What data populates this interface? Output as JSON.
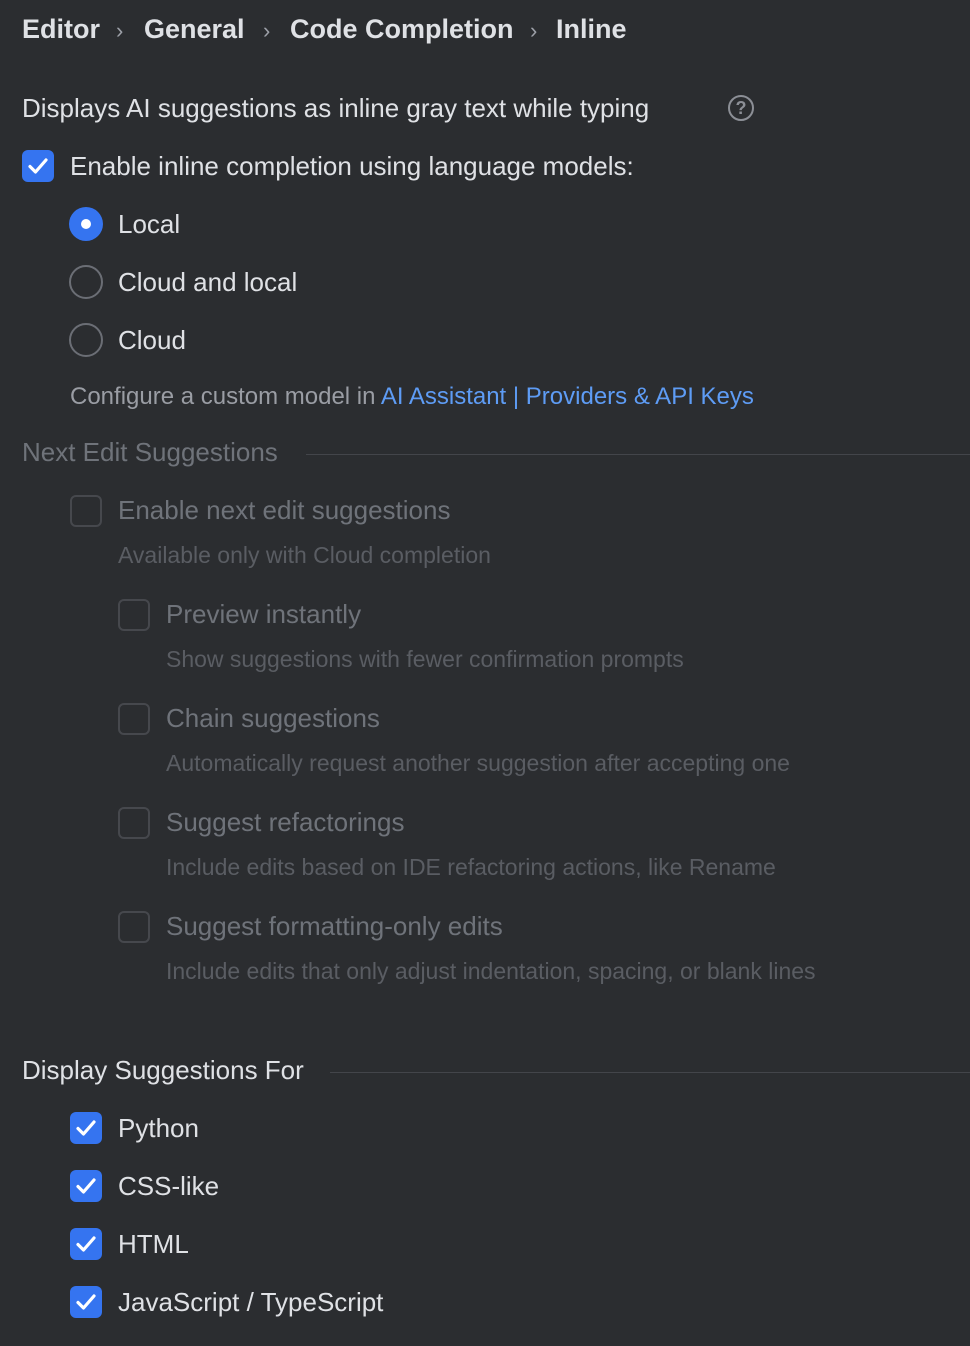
{
  "breadcrumb": {
    "items": [
      "Editor",
      "General",
      "Code Completion",
      "Inline"
    ],
    "separator": "›"
  },
  "description": "Displays AI suggestions as inline gray text while typing",
  "help_icon_glyph": "?",
  "enable_inline": {
    "label": "Enable inline completion using language models:",
    "checked": true
  },
  "model_options": [
    {
      "label": "Local",
      "selected": true
    },
    {
      "label": "Cloud and local",
      "selected": false
    },
    {
      "label": "Cloud",
      "selected": false
    }
  ],
  "configure": {
    "prefix": "Configure a custom model in ",
    "link1": "AI Assistant",
    "separator": "|",
    "link2": "Providers & API Keys"
  },
  "next_edit": {
    "title": "Next Edit Suggestions",
    "enable_label": "Enable next edit suggestions",
    "enable_hint": "Available only with Cloud completion",
    "options": [
      {
        "label": "Preview instantly",
        "hint": "Show suggestions with fewer confirmation prompts"
      },
      {
        "label": "Chain suggestions",
        "hint": "Automatically request another suggestion after accepting one"
      },
      {
        "label": "Suggest refactorings",
        "hint": "Include edits based on IDE refactoring actions, like Rename"
      },
      {
        "label": "Suggest formatting-only edits",
        "hint": "Include edits that only adjust indentation, spacing, or blank lines"
      }
    ]
  },
  "display_for": {
    "title": "Display Suggestions For",
    "languages": [
      {
        "label": "Python",
        "checked": true
      },
      {
        "label": "CSS-like",
        "checked": true
      },
      {
        "label": "HTML",
        "checked": true
      },
      {
        "label": "JavaScript / TypeScript",
        "checked": true
      }
    ]
  },
  "colors": {
    "background": "#2b2d30",
    "accent": "#3574f0",
    "link": "#5e9cf5",
    "text": "#dfe1e5",
    "disabled_text": "#6f737a"
  }
}
